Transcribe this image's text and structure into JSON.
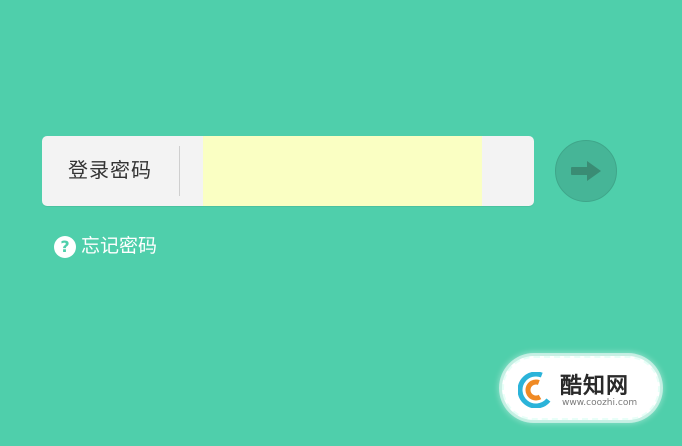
{
  "login": {
    "label": "登录密码",
    "password_value": "",
    "submit_icon": "arrow-right-icon"
  },
  "forgot": {
    "icon": "help-circle-icon",
    "icon_glyph": "?",
    "label": "忘记密码"
  },
  "watermark": {
    "name": "酷知网",
    "url": "www.coozhi.com"
  },
  "colors": {
    "background": "#4FCFAB",
    "input_bar": "#F3F3F3",
    "input_fill": "#FAFFC3",
    "button": "#46B597",
    "arrow": "#3A8C74"
  }
}
